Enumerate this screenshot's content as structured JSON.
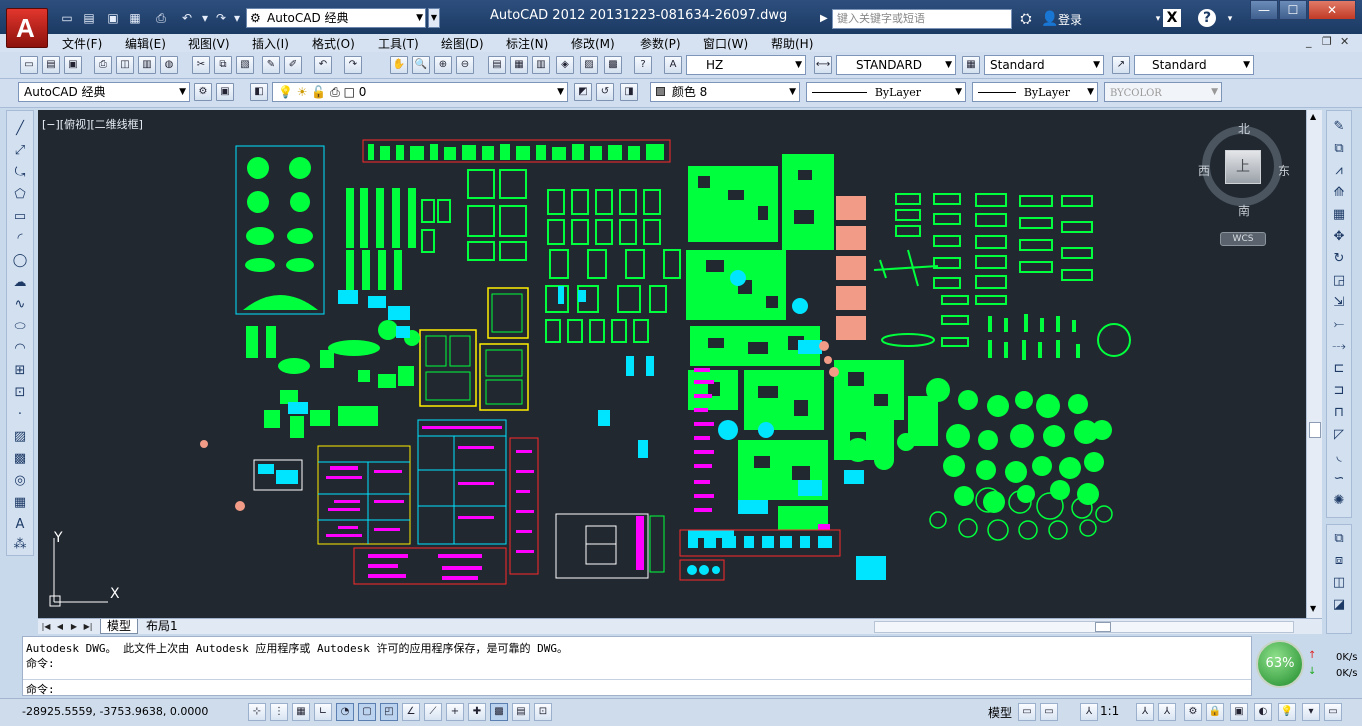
{
  "app": {
    "logo_letter": "A",
    "workspace": "AutoCAD 经典",
    "title": "AutoCAD 2012     20131223-081634-26097.dwg",
    "search_placeholder": "键入关键字或短语",
    "login": "登录"
  },
  "menu": [
    "文件(F)",
    "编辑(E)",
    "视图(V)",
    "插入(I)",
    "格式(O)",
    "工具(T)",
    "绘图(D)",
    "标注(N)",
    "修改(M)",
    "参数(P)",
    "窗口(W)",
    "帮助(H)"
  ],
  "styles": {
    "text_style": "HZ",
    "dim_style": "STANDARD",
    "table_style": "Standard",
    "mleader_style": "Standard"
  },
  "layers": {
    "workspace": "AutoCAD 经典",
    "layer": "0",
    "color": "颜色 8",
    "linetype": "ByLayer",
    "lineweight": "ByLayer",
    "plotstyle": "BYCOLOR"
  },
  "viewport": {
    "label": "[−][俯视][二维线框]",
    "compass": {
      "north": "北",
      "south": "南",
      "east": "东",
      "west": "西",
      "top": "上"
    },
    "wcs": "WCS",
    "ucs_x": "X",
    "ucs_y": "Y"
  },
  "tabs": {
    "model": "模型",
    "layout": "布局1"
  },
  "command": {
    "history": [
      "Autodesk DWG。   此文件上次由 Autodesk 应用程序或 Autodesk 许可的应用程序保存，是可靠的 DWG。",
      "命令:"
    ],
    "prompt": "命令:"
  },
  "perf": {
    "percent": "63%",
    "up": "0K/s",
    "down": "0K/s"
  },
  "status": {
    "coords": "-28925.5559, -3753.9638, 0.0000",
    "model": "模型",
    "scale": "1:1"
  },
  "colors": {
    "canvas": "#212830",
    "green": "#00ff3c",
    "cyan": "#00e5ff",
    "magenta": "#ff00ff",
    "red": "#ff2a2a",
    "yellow": "#ffee00",
    "salmon": "#f29b86"
  }
}
